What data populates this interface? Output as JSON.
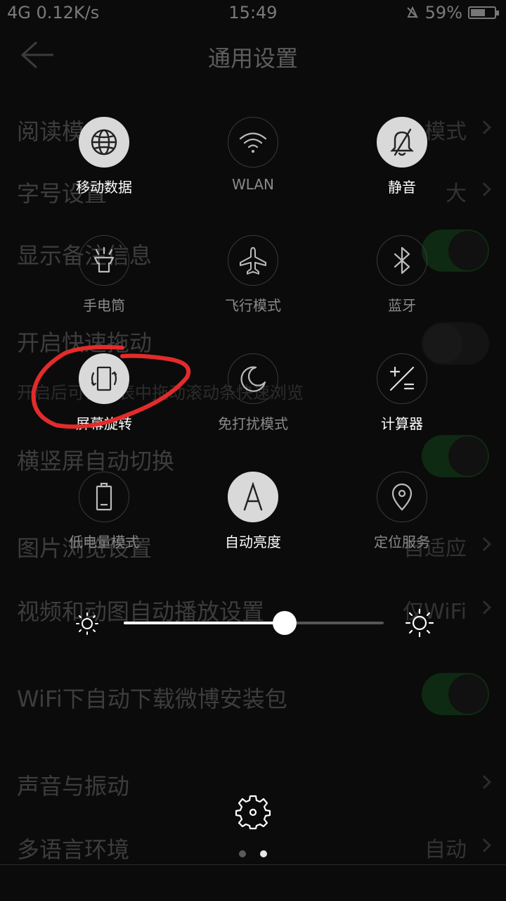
{
  "status_bar": {
    "network": "4G 0.12K/s",
    "time": "15:49",
    "battery": "59%",
    "alarm_icon": "alarm-off-icon"
  },
  "header": {
    "title": "通用设置",
    "back_icon": "back-arrow-icon"
  },
  "settings": {
    "reading_mode": {
      "label": "阅读模式",
      "value": "模式"
    },
    "font_size": {
      "label": "字号设置",
      "value": "大"
    },
    "show_remark": {
      "label": "显示备注信息"
    },
    "quick_drag": {
      "label": "开启快速拖动",
      "sub": "开启后可在列表中拖动滚动条快速浏览"
    },
    "auto_rotate": {
      "label": "横竖屏自动切换"
    },
    "image_browse": {
      "label": "图片浏览设置",
      "value": "自适应"
    },
    "video_autoplay": {
      "label": "视频和动图自动播放设置",
      "value": "仅WiFi"
    },
    "wifi_download": {
      "label": "WiFi下自动下载微博安装包"
    },
    "sound": {
      "label": "声音与振动"
    },
    "language": {
      "label": "多语言环境",
      "value": "自动"
    }
  },
  "control_center": {
    "tiles": [
      {
        "label": "移动数据",
        "icon": "mobile-data-globe-icon",
        "on": true
      },
      {
        "label": "WLAN",
        "icon": "wifi-icon",
        "on": false
      },
      {
        "label": "静音",
        "icon": "silent-bell-icon",
        "on": true
      },
      {
        "label": "手电筒",
        "icon": "flashlight-icon",
        "on": false
      },
      {
        "label": "飞行模式",
        "icon": "airplane-icon",
        "on": false
      },
      {
        "label": "蓝牙",
        "icon": "bluetooth-icon",
        "on": false
      },
      {
        "label": "屏幕旋转",
        "icon": "screen-rotation-icon",
        "on": true
      },
      {
        "label": "免打扰模式",
        "icon": "moon-icon",
        "on": false
      },
      {
        "label": "计算器",
        "icon": "calculator-icon",
        "on": false
      },
      {
        "label": "低电量模式",
        "icon": "battery-icon",
        "on": false
      },
      {
        "label": "自动亮度",
        "icon": "auto-brightness-icon",
        "on": true
      },
      {
        "label": "定位服务",
        "icon": "location-pin-icon",
        "on": false
      }
    ],
    "brightness_level": 0.62,
    "settings_icon": "gear-icon",
    "pager": {
      "pages": 2,
      "current": 2
    }
  },
  "colors": {
    "tile_on": "#d9d9d9",
    "annotation_red": "#e32b2b",
    "toggle_on_dim": "#0f2a12"
  }
}
